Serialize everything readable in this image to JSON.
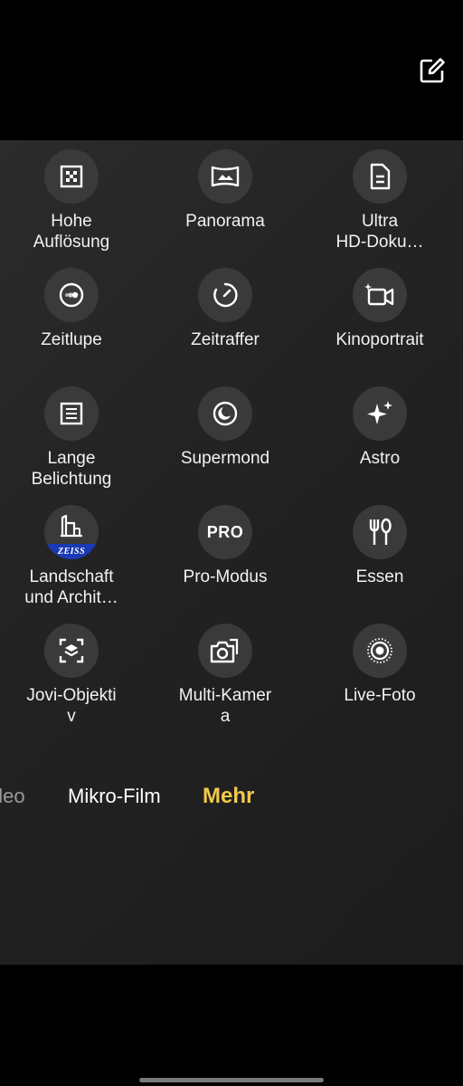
{
  "header": {
    "edit_icon": "edit-square-icon"
  },
  "modes": [
    {
      "id": "hohe-aufloesung",
      "label": "Hohe\nAuflösung",
      "icon": "high-res-icon"
    },
    {
      "id": "panorama",
      "label": "Panorama",
      "icon": "panorama-icon"
    },
    {
      "id": "ultra-hd-doku",
      "label": "Ultra\nHD-Doku…",
      "icon": "document-icon"
    },
    {
      "id": "zeitlupe",
      "label": "Zeitlupe",
      "icon": "slow-motion-icon"
    },
    {
      "id": "zeitraffer",
      "label": "Zeitraffer",
      "icon": "timelapse-icon"
    },
    {
      "id": "kinoportrait",
      "label": "Kinoportrait",
      "icon": "cinema-portrait-icon"
    },
    {
      "id": "lange-belichtung",
      "label": "Lange\nBelichtung",
      "icon": "long-exposure-icon"
    },
    {
      "id": "supermond",
      "label": "Supermond",
      "icon": "moon-icon"
    },
    {
      "id": "astro",
      "label": "Astro",
      "icon": "sparkle-icon"
    },
    {
      "id": "landschaft",
      "label": "Landschaft\nund Archit…",
      "icon": "zeiss-landscape-icon",
      "badge": "ZEISS"
    },
    {
      "id": "pro-modus",
      "label": "Pro-Modus",
      "icon": "pro-icon",
      "icon_text": "PRO"
    },
    {
      "id": "essen",
      "label": "Essen",
      "icon": "fork-knife-icon"
    },
    {
      "id": "jovi-objektiv",
      "label": "Jovi-Objekti\nv",
      "icon": "scan-layers-icon"
    },
    {
      "id": "multi-kamera",
      "label": "Multi-Kamer\na",
      "icon": "multi-camera-icon"
    },
    {
      "id": "live-foto",
      "label": "Live-Foto",
      "icon": "live-photo-icon"
    }
  ],
  "tabs": {
    "video": "ideo",
    "mikro_film": "Mikro-Film",
    "mehr": "Mehr"
  },
  "colors": {
    "accent": "#f2c94c",
    "zeiss_blue": "#1a3ab4"
  }
}
